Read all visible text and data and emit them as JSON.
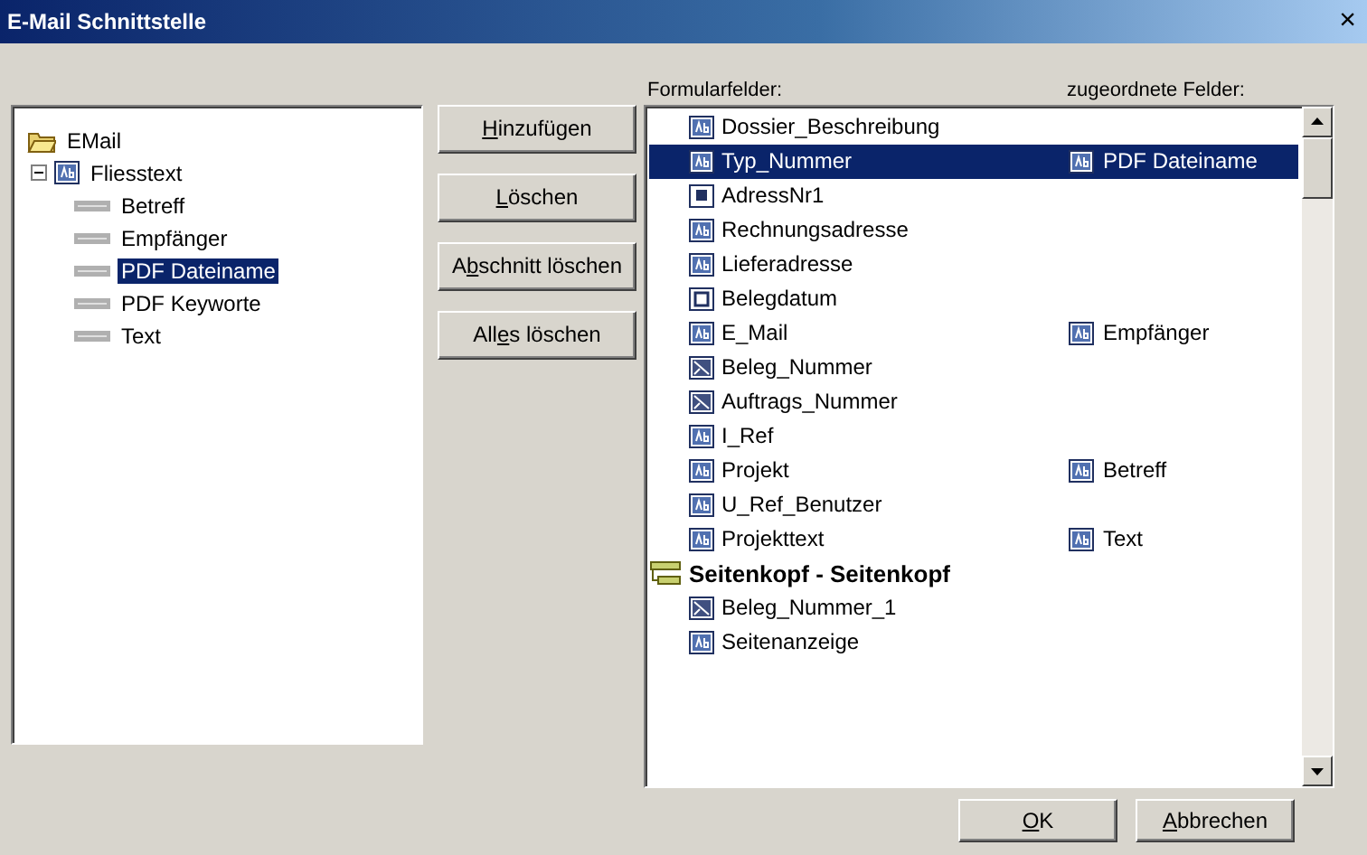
{
  "window": {
    "title": "E-Mail Schnittstelle",
    "close": "×"
  },
  "tree": {
    "label": "EMail",
    "children": [
      {
        "label": "Fliesstext",
        "expanded": true,
        "children": [
          {
            "label": "Betreff",
            "selected": false
          },
          {
            "label": "Empfänger",
            "selected": false
          },
          {
            "label": "PDF Dateiname",
            "selected": true
          },
          {
            "label": "PDF Keyworte",
            "selected": false
          },
          {
            "label": "Text",
            "selected": false
          }
        ]
      }
    ]
  },
  "buttons": [
    {
      "label": "Hinzufügen"
    },
    {
      "label": "Löschen"
    },
    {
      "label": "Abschnitt löschen"
    },
    {
      "label": "Alles löschen"
    }
  ],
  "list": {
    "columns": [
      "Formularfelder:",
      "zugeordnete Felder:"
    ],
    "rows": [
      {
        "kind": "text",
        "name": "Dossier_Beschreibung",
        "selected": false
      },
      {
        "kind": "text",
        "name": "Typ_Nummer",
        "selected": true,
        "assigned": "PDF Dateiname"
      },
      {
        "kind": "id",
        "name": "AdressNr1",
        "selected": false
      },
      {
        "kind": "text",
        "name": "Rechnungsadresse",
        "selected": false
      },
      {
        "kind": "text",
        "name": "Lieferadresse",
        "selected": false
      },
      {
        "kind": "date",
        "name": "Belegdatum",
        "selected": false
      },
      {
        "kind": "text",
        "name": "E_Mail",
        "selected": false,
        "assigned": "Empfänger"
      },
      {
        "kind": "counter",
        "name": "Beleg_Nummer",
        "selected": false
      },
      {
        "kind": "counter",
        "name": "Auftrags_Nummer",
        "selected": false
      },
      {
        "kind": "text",
        "name": "I_Ref",
        "selected": false
      },
      {
        "kind": "text",
        "name": "Projekt",
        "selected": false,
        "assigned": "Betreff"
      },
      {
        "kind": "text",
        "name": "U_Ref_Benutzer",
        "selected": false
      },
      {
        "kind": "text",
        "name": "Projekttext",
        "selected": false,
        "assigned": "Text"
      },
      {
        "kind": "section",
        "name": "Seitenkopf - Seitenkopf",
        "selected": false
      },
      {
        "kind": "counter",
        "name": "Beleg_Nummer_1",
        "selected": false
      },
      {
        "kind": "text",
        "name": "Seitenanzeige",
        "selected": false
      }
    ]
  },
  "footer_buttons": [
    {
      "label": "OK"
    },
    {
      "label": "Abbrechen"
    }
  ]
}
